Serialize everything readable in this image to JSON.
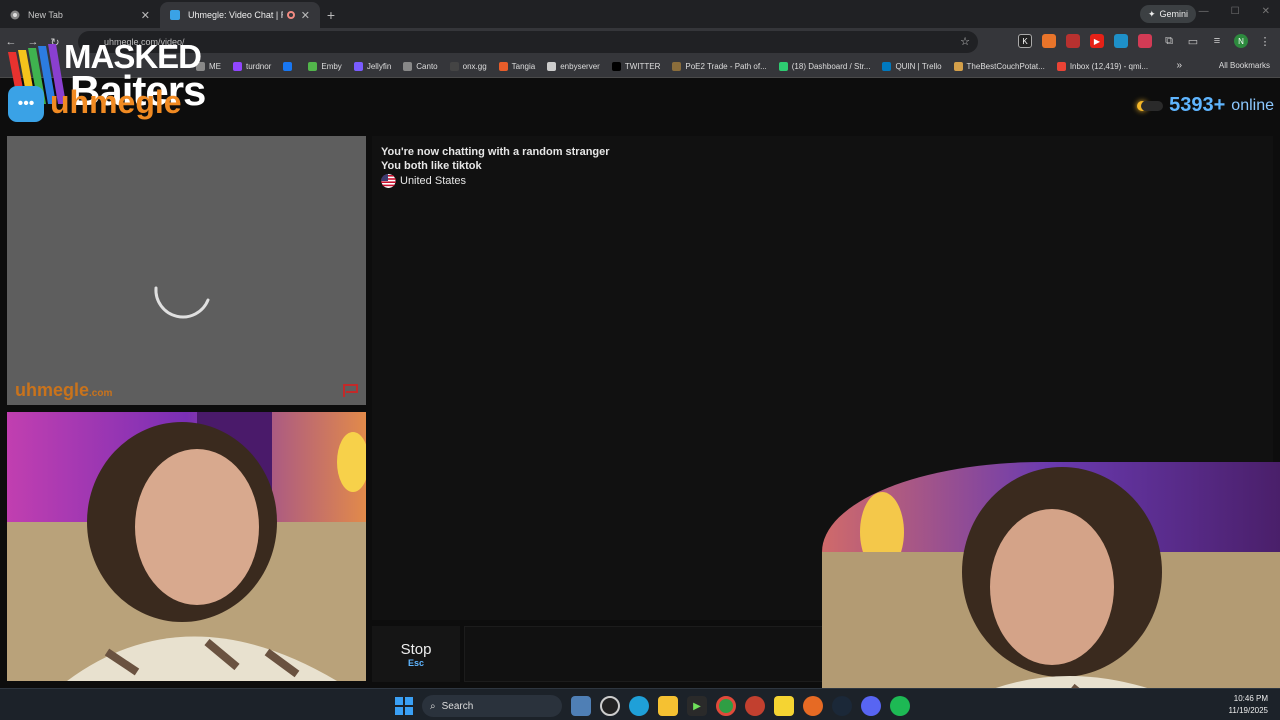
{
  "browser": {
    "tabs": [
      {
        "title": "New Tab",
        "active": false
      },
      {
        "title": "Uhmegle: Video Chat | Ran",
        "active": true
      }
    ],
    "gemini_label": "Gemini",
    "url": "uhmegle.com/video/",
    "profile_initial": "N",
    "bookmarks": [
      {
        "label": "ME",
        "color": "#888888"
      },
      {
        "label": "turdnor",
        "color": "#9146ff"
      },
      {
        "label": "",
        "color": "#1877f2"
      },
      {
        "label": "Emby",
        "color": "#52b54b"
      },
      {
        "label": "Jellyfin",
        "color": "#7a5cff"
      },
      {
        "label": "Canto",
        "color": "#888888"
      },
      {
        "label": "onx.gg",
        "color": "#444444"
      },
      {
        "label": "Tangia",
        "color": "#e85d2a"
      },
      {
        "label": "enbyserver",
        "color": "#cccccc"
      },
      {
        "label": "TWITTER",
        "color": "#000000"
      },
      {
        "label": "PoE2 Trade - Path of...",
        "color": "#8a6d3b"
      },
      {
        "label": "(18) Dashboard / Str...",
        "color": "#2ecc71"
      },
      {
        "label": "QUIN | Trello",
        "color": "#0079bf"
      },
      {
        "label": "TheBestCouchPotat...",
        "color": "#d4a04a"
      },
      {
        "label": "Inbox (12,419) - qmi...",
        "color": "#ea4335"
      }
    ],
    "all_bookmarks_label": "All Bookmarks"
  },
  "overlay_logo": {
    "line1": "MASKED",
    "line2": "Baiters"
  },
  "site": {
    "logo_text": "uhmegle",
    "online_count": "5393+",
    "online_label": "online",
    "watermark": "uhmegle",
    "watermark_suffix": ".com"
  },
  "chat": {
    "line1": "You're now chatting with a random stranger",
    "line2": "You both like tiktok",
    "country": "United States",
    "stop_label": "Stop",
    "stop_key": "Esc"
  },
  "taskbar": {
    "search_label": "Search",
    "time": "10:46 PM",
    "date": "11/19/2025"
  }
}
